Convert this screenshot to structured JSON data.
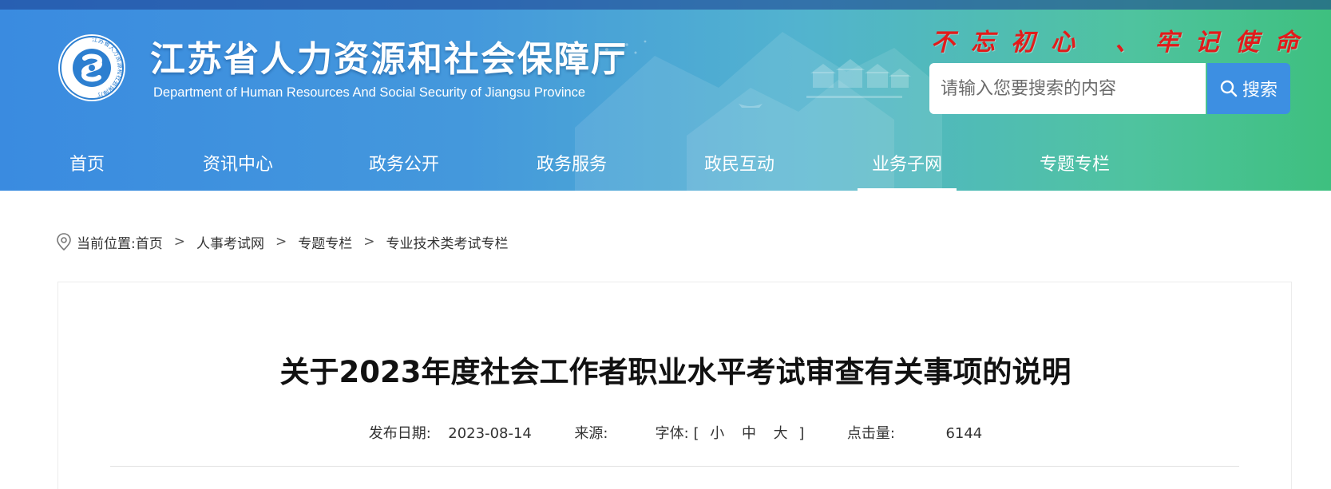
{
  "header": {
    "title": "江苏省人力资源和社会保障厅",
    "subtitle": "Department of Human Resources And Social Security of Jiangsu Province",
    "slogan": "不忘初心 、牢记使命",
    "logo_text": "江苏省人力资源和社会保障厅",
    "search": {
      "placeholder": "请输入您要搜索的内容",
      "button_label": "搜索"
    }
  },
  "nav": {
    "items": [
      {
        "label": "首页"
      },
      {
        "label": "资讯中心"
      },
      {
        "label": "政务公开"
      },
      {
        "label": "政务服务"
      },
      {
        "label": "政民互动"
      },
      {
        "label": "业务子网",
        "active": true
      },
      {
        "label": "专题专栏"
      }
    ]
  },
  "breadcrumb": {
    "prefix": "当前位置:",
    "items": [
      "首页",
      "人事考试网",
      "专题专栏",
      "专业技术类考试专栏"
    ],
    "separator": ">"
  },
  "article": {
    "title": "关于2023年度社会工作者职业水平考试审查有关事项的说明",
    "meta": {
      "date_label": "发布日期:",
      "date": "2023-08-14",
      "source_label": "来源:",
      "source": "",
      "font_label": "字体:",
      "font_open": "[",
      "font_sizes": [
        "小",
        "中",
        "大"
      ],
      "font_close": "]",
      "clicks_label": "点击量:",
      "clicks": "6144"
    }
  },
  "colors": {
    "header_gradient_start": "#3a8be0",
    "header_gradient_end": "#3ec07f",
    "slogan": "#e21b1b",
    "search_button": "#3d8fe2"
  },
  "icons": {
    "logo": "jiangsu-hrss-emblem",
    "search": "magnifier-icon",
    "location": "map-pin-icon"
  }
}
